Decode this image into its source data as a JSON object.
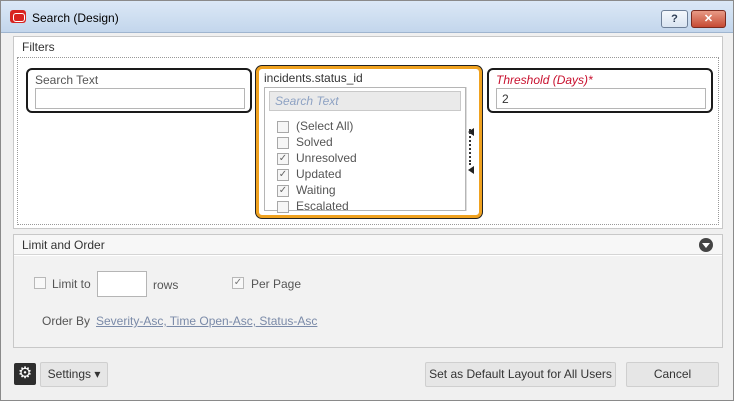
{
  "window": {
    "title": "Search (Design)",
    "help_label": "?",
    "close_label": "✕"
  },
  "filters": {
    "header": "Filters",
    "search_text": {
      "label": "Search Text",
      "value": ""
    },
    "status": {
      "label": "incidents.status_id",
      "search_placeholder": "Search Text",
      "options": [
        {
          "label": "(Select All)",
          "checked": false
        },
        {
          "label": "Solved",
          "checked": false
        },
        {
          "label": "Unresolved",
          "checked": true
        },
        {
          "label": "Updated",
          "checked": true
        },
        {
          "label": "Waiting",
          "checked": true
        },
        {
          "label": "Escalated",
          "checked": false
        }
      ]
    },
    "threshold": {
      "label": "Threshold (Days)*",
      "value": "2"
    }
  },
  "limit_order": {
    "header": "Limit and Order",
    "limit_label": "Limit to",
    "rows_label": "rows",
    "rows_value": "",
    "per_page_label": "Per Page",
    "per_page_checked": true,
    "limit_checked": false,
    "order_by_label": "Order By",
    "order_by_value": "Severity-Asc, Time Open-Asc, Status-Asc"
  },
  "footer": {
    "settings_label": "Settings ▾",
    "default_layout_label": "Set as Default Layout for All Users",
    "cancel_label": "Cancel"
  },
  "colors": {
    "accent": "#f0a21f",
    "required": "#c8102e",
    "link": "#7a8aa8"
  }
}
